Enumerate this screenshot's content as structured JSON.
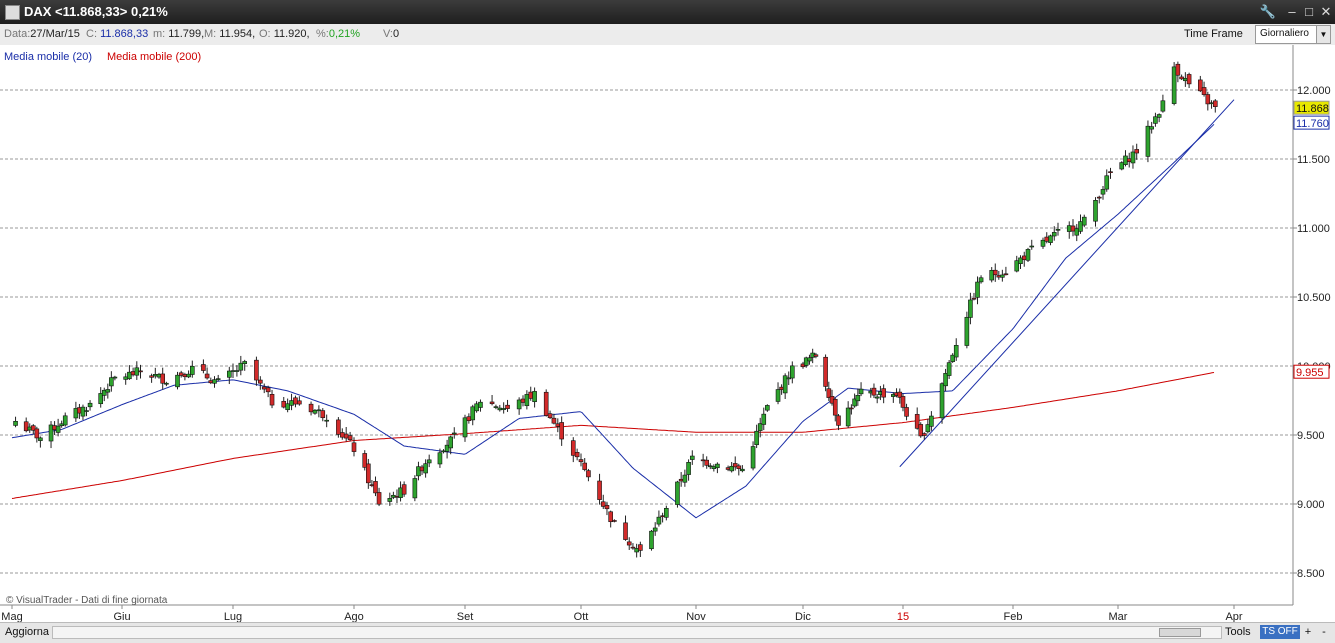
{
  "window": {
    "title": "DAX <11.868,33> 0,21%",
    "controls": [
      "🔧",
      "–",
      "□",
      "✕"
    ]
  },
  "infobar": {
    "date_label": "Data:",
    "date_value": "27/Mar/15",
    "close_label": "C:",
    "close_value": "11.868,33",
    "min_label": "m:",
    "min_value": "11.799,",
    "max_label": "M:",
    "max_value": "11.954,",
    "open_label": "O:",
    "open_value": "11.920,",
    "pct_label": "%:",
    "pct_value": "0,21%",
    "vol_label": "V:",
    "vol_value": "0",
    "timeframe_label": "Time Frame",
    "timeframe_value": "Giornaliero"
  },
  "legend": {
    "ma20": "Media mobile (20)",
    "ma200": "Media mobile (200)"
  },
  "footer_note": "© VisualTrader - Dati di fine giornata",
  "bottombar": {
    "refresh_label": "Aggiorna",
    "tools_label": "Tools",
    "ts_label": "TS OFF",
    "plus": "+",
    "minus": "-"
  },
  "chart_data": {
    "type": "candlestick",
    "title": "DAX",
    "y_ticks": [
      "12.000",
      "11.500",
      "11.000",
      "10.500",
      "10.000",
      "9.500",
      "9.000",
      "8.500"
    ],
    "y_tick_values": [
      12000,
      11500,
      11000,
      10500,
      10000,
      9500,
      9000,
      8500
    ],
    "ylim": [
      8300,
      12250
    ],
    "x_labels": [
      "Mag",
      "Giu",
      "Lug",
      "Ago",
      "Set",
      "Ott",
      "Nov",
      "Dic",
      "15",
      "Feb",
      "Mar",
      "Apr"
    ],
    "x_label_dates": [
      "2014-05-01",
      "2014-06-01",
      "2014-07-01",
      "2014-08-01",
      "2014-09-01",
      "2014-10-01",
      "2014-11-01",
      "2014-12-01",
      "2015-01-01",
      "2015-02-01",
      "2015-03-01",
      "2015-04-01"
    ],
    "price_tags": [
      {
        "label": "11.868",
        "value": 11868,
        "color": "#e8e800"
      },
      {
        "label": "11.760",
        "value": 11760,
        "color": "#1a2ea8"
      },
      {
        "label": "9.955",
        "value": 9955,
        "color": "#cc0000"
      }
    ],
    "close_points": [
      {
        "date": "2014-05-02",
        "close": 9600
      },
      {
        "date": "2014-05-09",
        "close": 9480
      },
      {
        "date": "2014-05-16",
        "close": 9620
      },
      {
        "date": "2014-05-23",
        "close": 9720
      },
      {
        "date": "2014-05-30",
        "close": 9910
      },
      {
        "date": "2014-06-06",
        "close": 9960
      },
      {
        "date": "2014-06-13",
        "close": 9900
      },
      {
        "date": "2014-06-20",
        "close": 9980
      },
      {
        "date": "2014-06-27",
        "close": 9880
      },
      {
        "date": "2014-07-04",
        "close": 10010
      },
      {
        "date": "2014-07-11",
        "close": 9740
      },
      {
        "date": "2014-07-18",
        "close": 9730
      },
      {
        "date": "2014-07-25",
        "close": 9640
      },
      {
        "date": "2014-08-01",
        "close": 9400
      },
      {
        "date": "2014-08-08",
        "close": 9010
      },
      {
        "date": "2014-08-15",
        "close": 9100
      },
      {
        "date": "2014-08-22",
        "close": 9340
      },
      {
        "date": "2014-08-29",
        "close": 9480
      },
      {
        "date": "2014-09-05",
        "close": 9750
      },
      {
        "date": "2014-09-12",
        "close": 9690
      },
      {
        "date": "2014-09-19",
        "close": 9800
      },
      {
        "date": "2014-09-26",
        "close": 9500
      },
      {
        "date": "2014-10-03",
        "close": 9200
      },
      {
        "date": "2014-10-10",
        "close": 8850
      },
      {
        "date": "2014-10-17",
        "close": 8650
      },
      {
        "date": "2014-10-24",
        "close": 8980
      },
      {
        "date": "2014-10-31",
        "close": 9330
      },
      {
        "date": "2014-11-07",
        "close": 9290
      },
      {
        "date": "2014-11-14",
        "close": 9250
      },
      {
        "date": "2014-11-21",
        "close": 9700
      },
      {
        "date": "2014-11-28",
        "close": 9980
      },
      {
        "date": "2014-12-05",
        "close": 10080
      },
      {
        "date": "2014-12-12",
        "close": 9600
      },
      {
        "date": "2014-12-19",
        "close": 9800
      },
      {
        "date": "2014-12-30",
        "close": 9800
      },
      {
        "date": "2015-01-06",
        "close": 9470
      },
      {
        "date": "2015-01-09",
        "close": 9650
      },
      {
        "date": "2015-01-16",
        "close": 10170
      },
      {
        "date": "2015-01-23",
        "close": 10650
      },
      {
        "date": "2015-01-30",
        "close": 10690
      },
      {
        "date": "2015-02-06",
        "close": 10840
      },
      {
        "date": "2015-02-13",
        "close": 10960
      },
      {
        "date": "2015-02-20",
        "close": 11050
      },
      {
        "date": "2015-02-27",
        "close": 11400
      },
      {
        "date": "2015-03-06",
        "close": 11560
      },
      {
        "date": "2015-03-13",
        "close": 11900
      },
      {
        "date": "2015-03-16",
        "close": 12170
      },
      {
        "date": "2015-03-20",
        "close": 12040
      },
      {
        "date": "2015-03-27",
        "close": 11868
      }
    ],
    "series": [
      {
        "name": "Media mobile (20)",
        "color": "#1a2ea8",
        "points": [
          {
            "date": "2014-05-01",
            "value": 9480
          },
          {
            "date": "2014-05-15",
            "value": 9540
          },
          {
            "date": "2014-06-01",
            "value": 9720
          },
          {
            "date": "2014-06-15",
            "value": 9860
          },
          {
            "date": "2014-07-01",
            "value": 9900
          },
          {
            "date": "2014-07-15",
            "value": 9820
          },
          {
            "date": "2014-08-01",
            "value": 9650
          },
          {
            "date": "2014-08-15",
            "value": 9420
          },
          {
            "date": "2014-09-01",
            "value": 9360
          },
          {
            "date": "2014-09-15",
            "value": 9620
          },
          {
            "date": "2014-10-01",
            "value": 9670
          },
          {
            "date": "2014-10-15",
            "value": 9260
          },
          {
            "date": "2014-11-01",
            "value": 8900
          },
          {
            "date": "2014-11-15",
            "value": 9130
          },
          {
            "date": "2014-12-01",
            "value": 9600
          },
          {
            "date": "2014-12-15",
            "value": 9840
          },
          {
            "date": "2015-01-01",
            "value": 9800
          },
          {
            "date": "2015-01-15",
            "value": 9820
          },
          {
            "date": "2015-02-01",
            "value": 10270
          },
          {
            "date": "2015-02-15",
            "value": 10780
          },
          {
            "date": "2015-03-01",
            "value": 11100
          },
          {
            "date": "2015-03-15",
            "value": 11450
          },
          {
            "date": "2015-03-27",
            "value": 11760
          }
        ]
      },
      {
        "name": "Media mobile (200)",
        "color": "#cc0000",
        "points": [
          {
            "date": "2014-05-01",
            "value": 9040
          },
          {
            "date": "2014-06-01",
            "value": 9170
          },
          {
            "date": "2014-07-01",
            "value": 9330
          },
          {
            "date": "2014-08-01",
            "value": 9460
          },
          {
            "date": "2014-09-01",
            "value": 9510
          },
          {
            "date": "2014-10-01",
            "value": 9570
          },
          {
            "date": "2014-11-01",
            "value": 9520
          },
          {
            "date": "2014-12-01",
            "value": 9520
          },
          {
            "date": "2015-01-01",
            "value": 9590
          },
          {
            "date": "2015-02-01",
            "value": 9700
          },
          {
            "date": "2015-03-01",
            "value": 9820
          },
          {
            "date": "2015-03-27",
            "value": 9955
          }
        ]
      }
    ],
    "trendline": {
      "start": {
        "date": "2014-12-31",
        "value": 9270
      },
      "end": {
        "date": "2015-04-02",
        "value": 11930
      }
    },
    "grid": "horizontal dashed"
  }
}
